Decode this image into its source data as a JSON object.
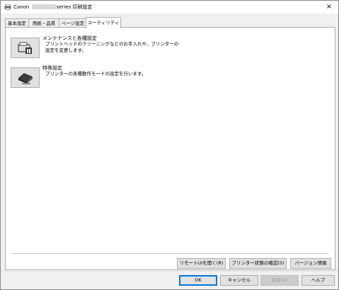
{
  "window": {
    "title_prefix": "Canon",
    "title_suffix": "series 印刷設定",
    "close_label": "×"
  },
  "tabs": [
    {
      "label": "基本設定"
    },
    {
      "label": "用紙・品質"
    },
    {
      "label": "ページ設定"
    },
    {
      "label": "ユーティリティ"
    }
  ],
  "utilities": [
    {
      "title": "メンテナンスと各種設定",
      "description": "プリントヘッドのクリーニングなどのお手入れや、プリンターの設定を変更します。",
      "icon": "maintenance-icon"
    },
    {
      "title": "特殊設定",
      "description": "プリンターの各種動作モードの設定を行います。",
      "icon": "special-settings-icon"
    }
  ],
  "panel_buttons": {
    "remote_ui": "リモートUIを開く(R)",
    "printer_status": "プリンター状態の確認(S)",
    "version_info": "バージョン情報"
  },
  "dialog_buttons": {
    "ok": "OK",
    "cancel": "キャンセル",
    "apply": "適用(A)",
    "help": "ヘルプ"
  }
}
